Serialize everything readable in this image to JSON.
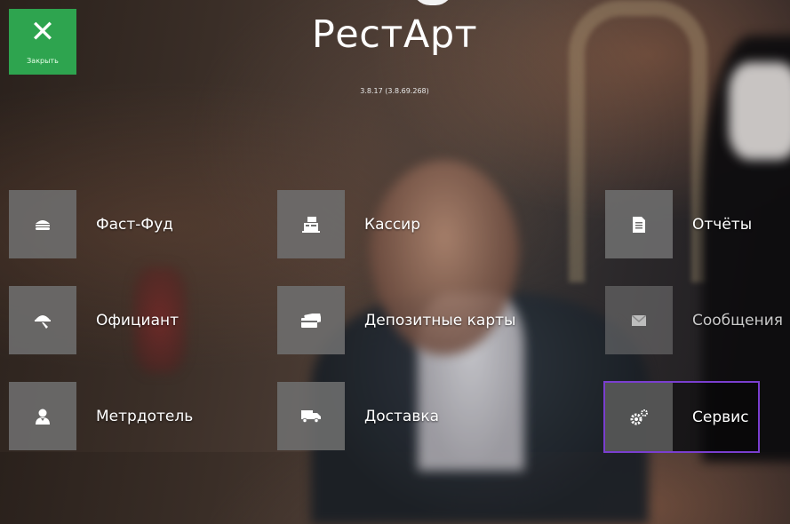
{
  "header": {
    "close_label": "Закрыть",
    "app_title": "РестАрт",
    "version": "3.8.17 (3.8.69.268)"
  },
  "menu": [
    {
      "label": "Фаст-Фуд",
      "icon": "burger-icon"
    },
    {
      "label": "Кассир",
      "icon": "cash-register-icon"
    },
    {
      "label": "Отчёты",
      "icon": "document-icon"
    },
    {
      "label": "Официант",
      "icon": "waiter-icon"
    },
    {
      "label": "Депозитные карты",
      "icon": "card-icon"
    },
    {
      "label": "Сообщения",
      "icon": "envelope-icon"
    },
    {
      "label": "Метрдотель",
      "icon": "person-icon"
    },
    {
      "label": "Доставка",
      "icon": "truck-icon"
    },
    {
      "label": "Сервис",
      "icon": "gears-icon"
    }
  ],
  "colors": {
    "close_tile": "#2ea44f",
    "tile_bg": "#6e6e6e",
    "selected_border": "#7a3ecf"
  }
}
